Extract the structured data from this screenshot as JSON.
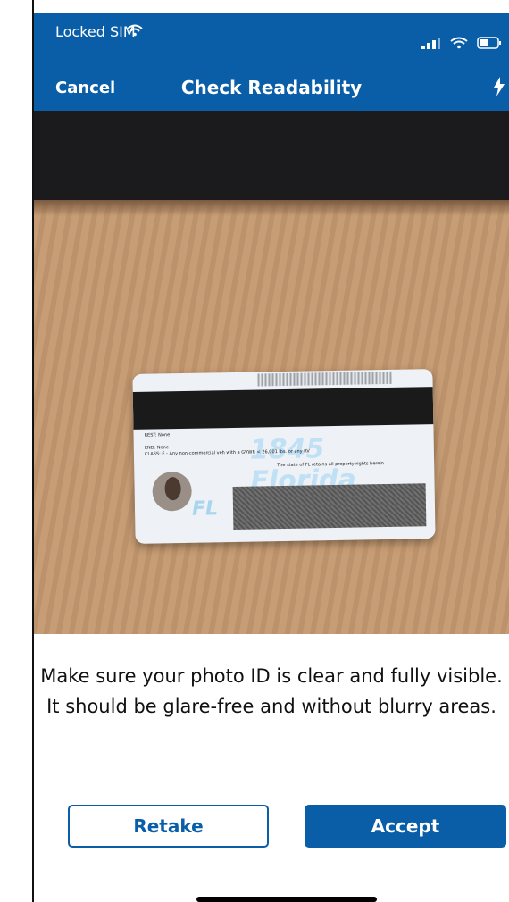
{
  "status": {
    "carrier": "Locked SIM"
  },
  "nav": {
    "cancel": "Cancel",
    "title": "Check Readability"
  },
  "card": {
    "line1": "REST: None",
    "line2": "END: None",
    "line3": "CLASS: E - Any non-commercial veh with a GVWR < 26,001 lbs. or any RV",
    "line4": "The state of FL retains all property rights herein.",
    "state": "Florida",
    "year": "1845",
    "abbrev": "FL"
  },
  "instruction": "Make sure your photo ID is clear and fully visible. It should be glare-free and without blurry areas.",
  "buttons": {
    "retake": "Retake",
    "accept": "Accept"
  },
  "colors": {
    "brand": "#0a5ea8"
  }
}
